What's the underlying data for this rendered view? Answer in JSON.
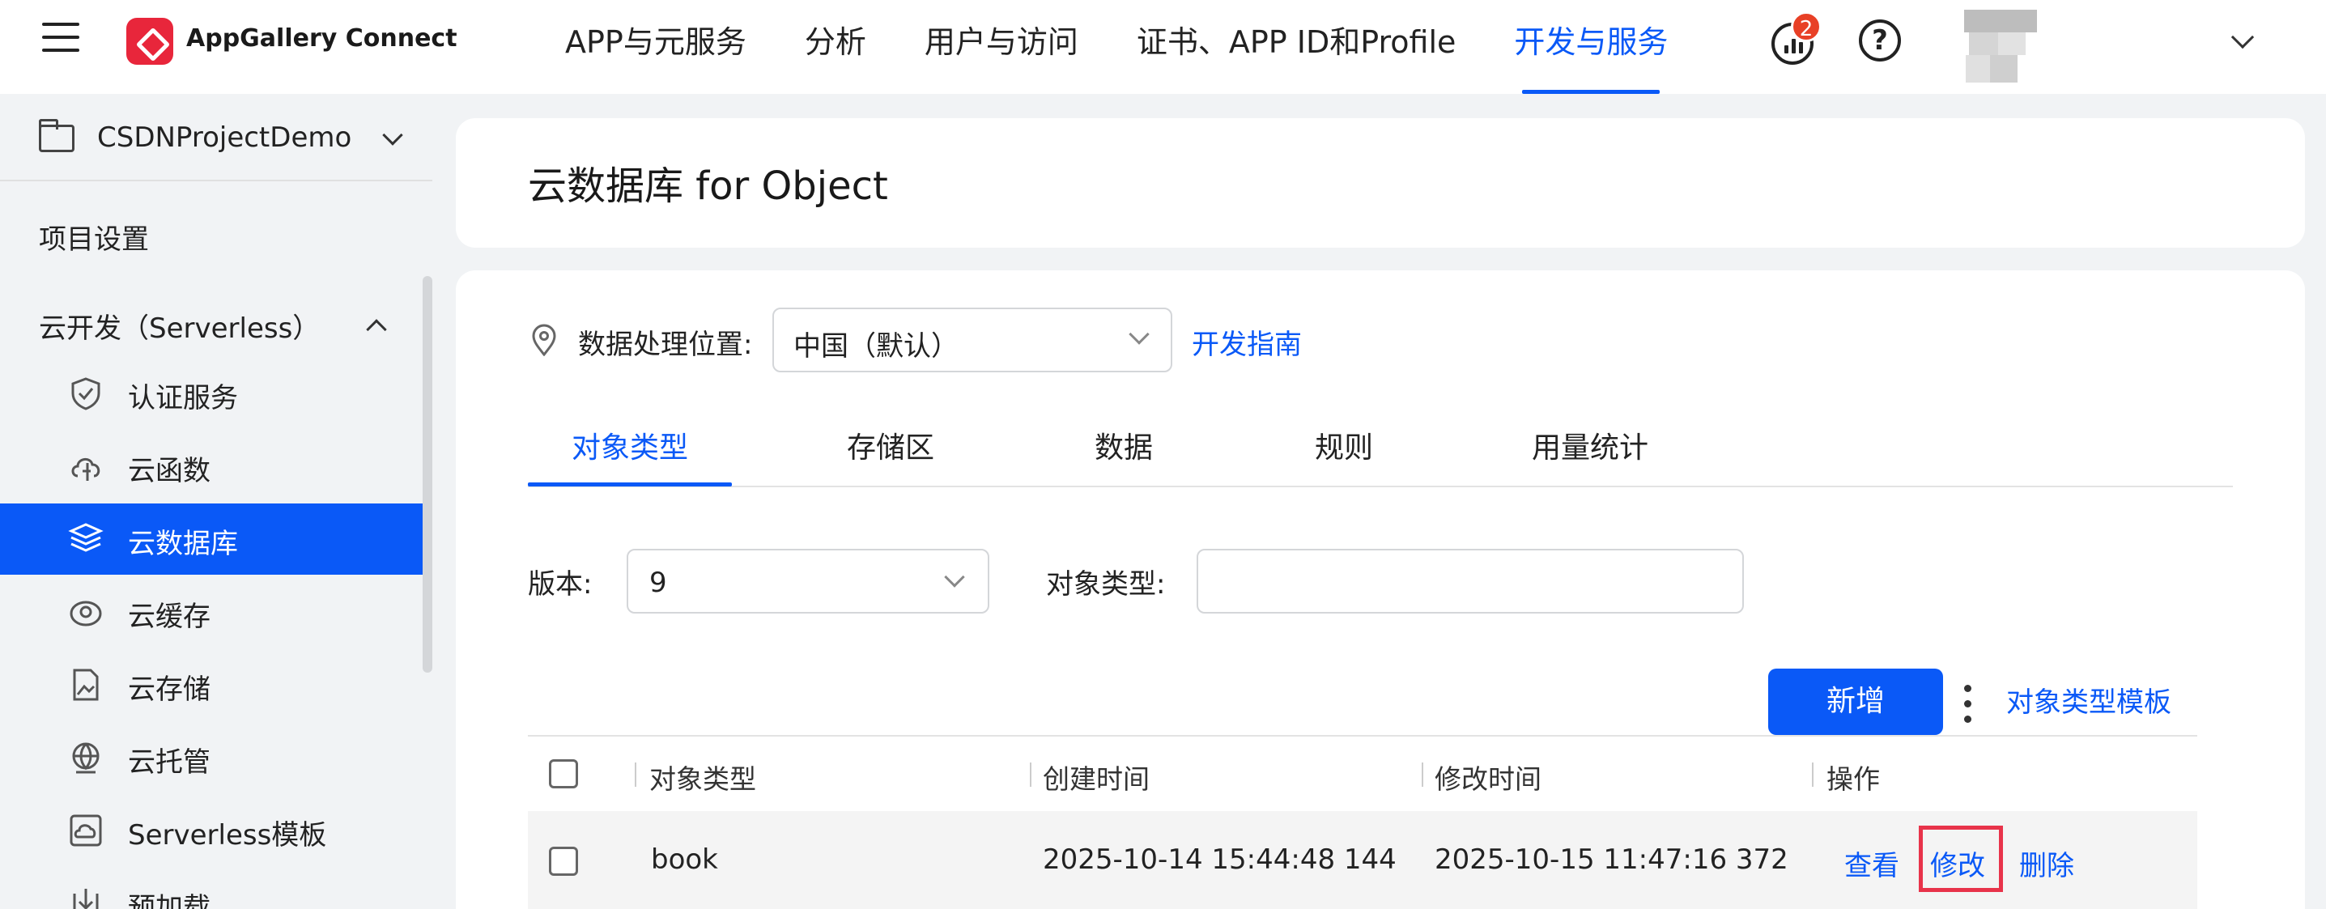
{
  "header": {
    "brand": "AppGallery Connect",
    "nav": [
      "APP与元服务",
      "分析",
      "用户与访问",
      "证书、APP ID和Profile",
      "开发与服务"
    ],
    "active_nav_index": 4,
    "notification_count": "2",
    "help_glyph": "?"
  },
  "sidebar": {
    "project_name": "CSDNProjectDemo",
    "project_settings": "项目设置",
    "group_label": "云开发（Serverless）",
    "items": [
      {
        "label": "认证服务",
        "icon": "shield-check-icon"
      },
      {
        "label": "云函数",
        "icon": "cloud-function-icon"
      },
      {
        "label": "云数据库",
        "icon": "database-layers-icon",
        "active": true
      },
      {
        "label": "云缓存",
        "icon": "cloud-cache-icon"
      },
      {
        "label": "云存储",
        "icon": "storage-image-icon"
      },
      {
        "label": "云托管",
        "icon": "globe-hosting-icon"
      },
      {
        "label": "Serverless模板",
        "icon": "template-cloud-icon"
      },
      {
        "label": "预加载",
        "icon": "preload-download-icon"
      }
    ]
  },
  "page": {
    "title": "云数据库 for Object",
    "location_label": "数据处理位置:",
    "location_value": "中国（默认）",
    "guide_link": "开发指南",
    "tabs": [
      "对象类型",
      "存储区",
      "数据",
      "规则",
      "用量统计"
    ],
    "active_tab_index": 0,
    "version_label": "版本:",
    "version_value": "9",
    "object_type_label": "对象类型:",
    "object_type_input": "",
    "add_button": "新增",
    "template_link": "对象类型模板"
  },
  "table": {
    "columns": [
      "对象类型",
      "创建时间",
      "修改时间",
      "操作"
    ],
    "rows": [
      {
        "object_type": "book",
        "created": "2025-10-14 15:44:48 144",
        "modified": "2025-10-15 11:47:16 372",
        "actions": [
          "查看",
          "修改",
          "删除"
        ],
        "highlighted_action": "修改"
      }
    ]
  },
  "colors": {
    "accent": "#0a59f7",
    "badge": "#e84026",
    "highlight_box": "#e8334a",
    "logo": "#e8263b"
  }
}
